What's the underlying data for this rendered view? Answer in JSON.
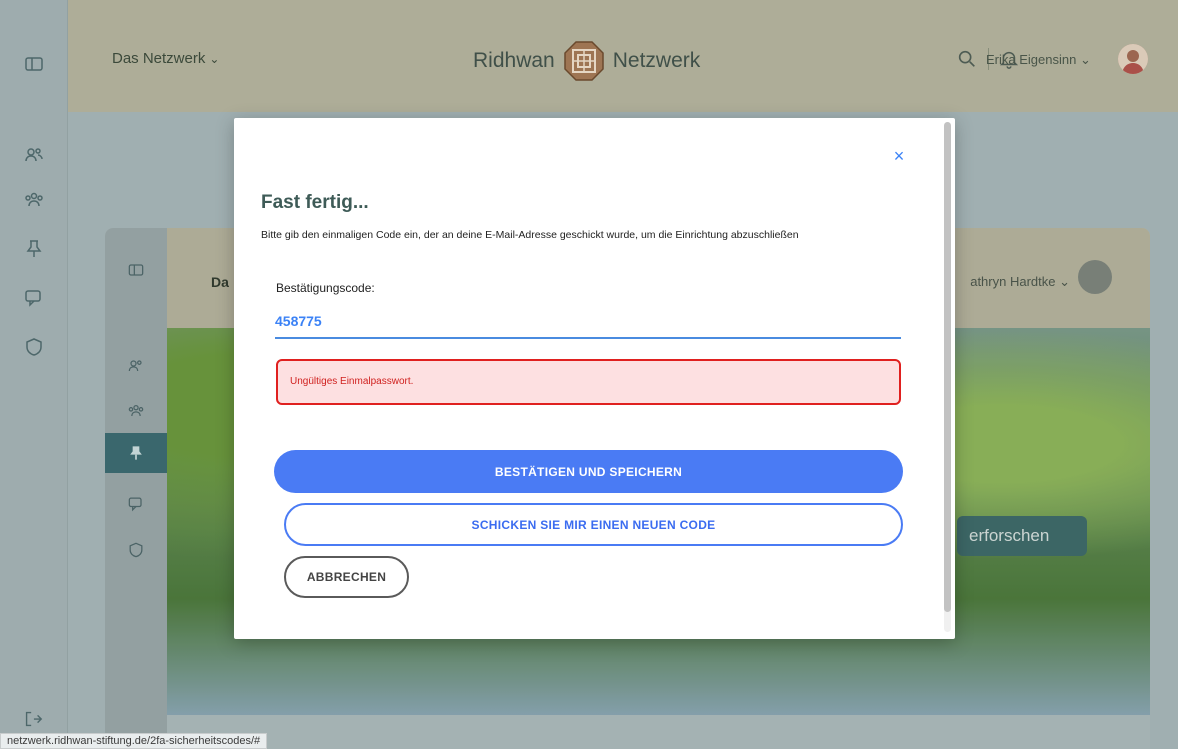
{
  "background": {
    "topbar": {
      "menu_title": "Das Netzwerk",
      "brand_left": "Ridhwan",
      "brand_right": "Netzwerk",
      "user_name": "Erika Eigensinn"
    },
    "inner_window": {
      "header_title": "Da",
      "user_name": "athryn Hardtke",
      "hero_button": "erforschen"
    },
    "left_rail_icons": [
      "sidebar-toggle-icon",
      "users-icon",
      "groups-icon",
      "pin-icon",
      "chat-icon",
      "shield-icon"
    ],
    "exit_icon": "logout-icon"
  },
  "modal": {
    "close_symbol": "×",
    "title": "Fast fertig...",
    "description": "Bitte gib den einmaligen Code ein, der an deine E-Mail-Adresse geschickt wurde, um die Einrichtung abzuschließen",
    "code_label": "Bestätigungscode:",
    "code_value": "458775",
    "error_message": "Ungültiges Einmalpasswort.",
    "confirm_button": "BESTÄTIGEN UND SPEICHERN",
    "resend_button": "SCHICKEN SIE MIR EINEN NEUEN CODE",
    "cancel_button": "ABBRECHEN"
  },
  "status_bar": {
    "url": "netzwerk.ridhwan-stiftung.de/2fa-sicherheitscodes/#"
  },
  "colors": {
    "accent": "#4a7bf4",
    "error": "#e0201f",
    "error_bg": "#fde0e1",
    "title": "#3e5b57"
  }
}
